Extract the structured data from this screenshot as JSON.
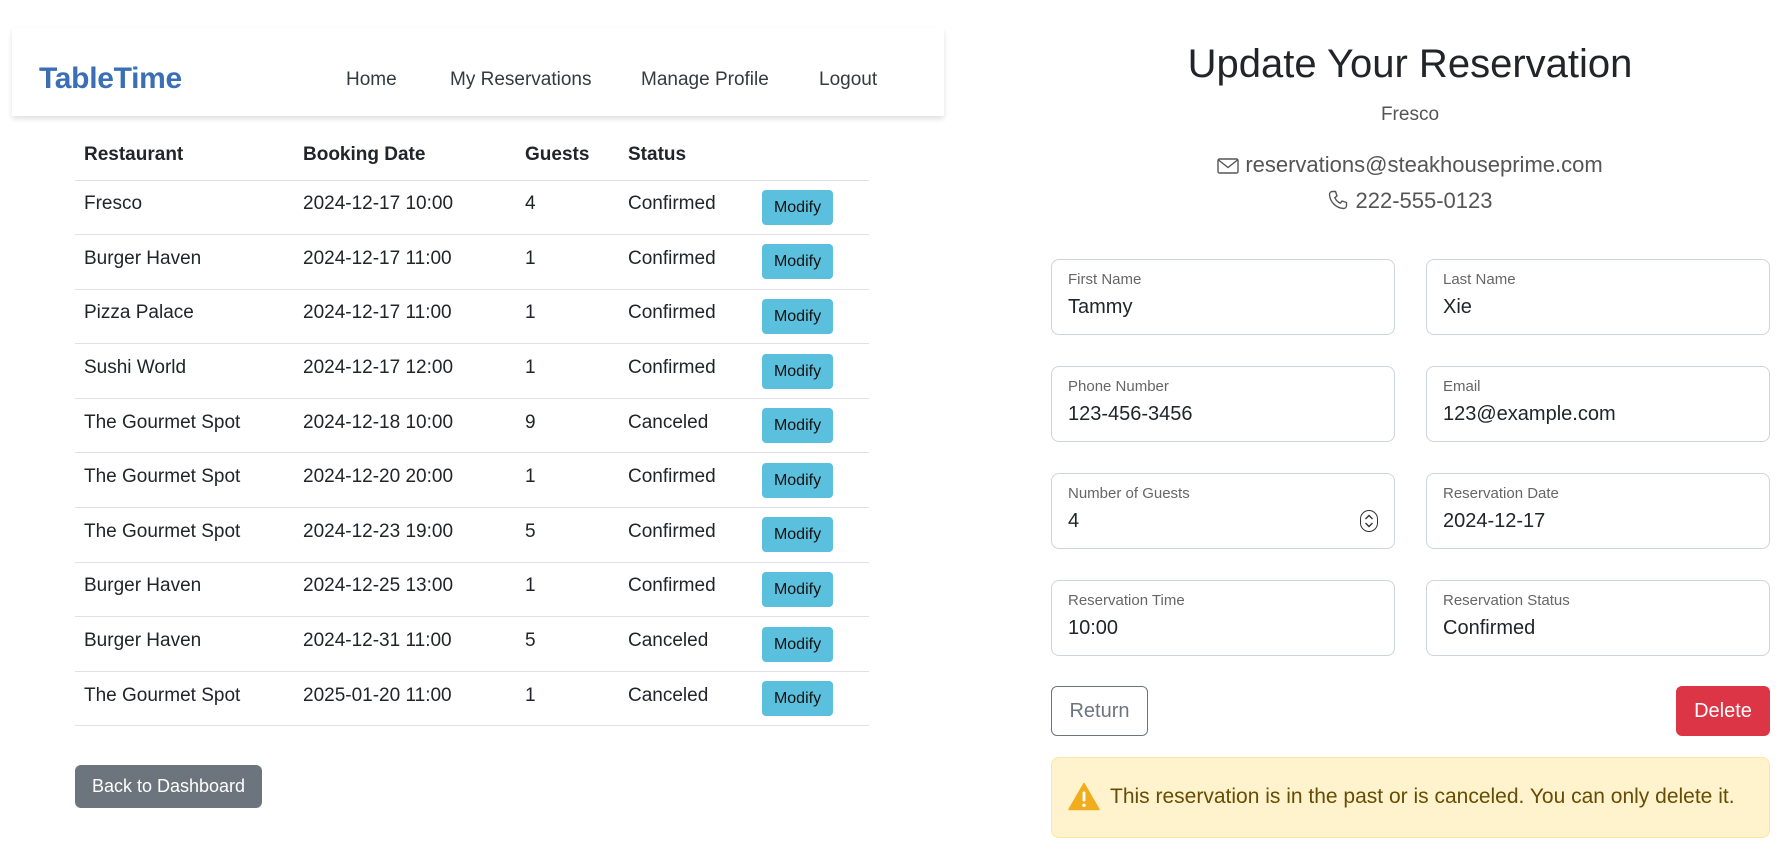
{
  "colors": {
    "brand": "#3a6fb5",
    "modify_button": "#5bc0de",
    "back_button": "#6c757d",
    "delete_button": "#dc3545",
    "alert_background": "#fff3cd",
    "alert_text": "#664d03"
  },
  "navbar": {
    "brand": "TableTime",
    "links": [
      "Home",
      "My Reservations",
      "Manage Profile",
      "Logout"
    ]
  },
  "reservations": {
    "headers": [
      "Restaurant",
      "Booking Date",
      "Guests",
      "Status"
    ],
    "modify_label": "Modify",
    "rows": [
      {
        "restaurant": "Fresco",
        "date": "2024-12-17 10:00",
        "guests": "4",
        "status": "Confirmed"
      },
      {
        "restaurant": "Burger Haven",
        "date": "2024-12-17 11:00",
        "guests": "1",
        "status": "Confirmed"
      },
      {
        "restaurant": "Pizza Palace",
        "date": "2024-12-17 11:00",
        "guests": "1",
        "status": "Confirmed"
      },
      {
        "restaurant": "Sushi World",
        "date": "2024-12-17 12:00",
        "guests": "1",
        "status": "Confirmed"
      },
      {
        "restaurant": "The Gourmet Spot",
        "date": "2024-12-18 10:00",
        "guests": "9",
        "status": "Canceled"
      },
      {
        "restaurant": "The Gourmet Spot",
        "date": "2024-12-20 20:00",
        "guests": "1",
        "status": "Confirmed"
      },
      {
        "restaurant": "The Gourmet Spot",
        "date": "2024-12-23 19:00",
        "guests": "5",
        "status": "Confirmed"
      },
      {
        "restaurant": "Burger Haven",
        "date": "2024-12-25 13:00",
        "guests": "1",
        "status": "Confirmed"
      },
      {
        "restaurant": "Burger Haven",
        "date": "2024-12-31 11:00",
        "guests": "5",
        "status": "Canceled"
      },
      {
        "restaurant": "The Gourmet Spot",
        "date": "2025-01-20 11:00",
        "guests": "1",
        "status": "Canceled"
      }
    ],
    "back_label": "Back to Dashboard"
  },
  "update_form": {
    "title": "Update Your Reservation",
    "restaurant": "Fresco",
    "email_icon": "envelope-icon",
    "email": "reservations@steakhouseprime.com",
    "phone_icon": "phone-icon",
    "phone": "222-555-0123",
    "fields": {
      "first_name": {
        "label": "First Name",
        "value": "Tammy"
      },
      "last_name": {
        "label": "Last Name",
        "value": "Xie"
      },
      "phone_number": {
        "label": "Phone Number",
        "value": "123-456-3456"
      },
      "email": {
        "label": "Email",
        "value": "123@example.com"
      },
      "guests": {
        "label": "Number of Guests",
        "value": "4"
      },
      "date": {
        "label": "Reservation Date",
        "value": "2024-12-17"
      },
      "time": {
        "label": "Reservation Time",
        "value": "10:00"
      },
      "status": {
        "label": "Reservation Status",
        "value": "Confirmed"
      }
    },
    "return_label": "Return",
    "delete_label": "Delete",
    "alert_icon": "warning-icon",
    "alert": "This reservation is in the past or is canceled. You can only delete it."
  }
}
